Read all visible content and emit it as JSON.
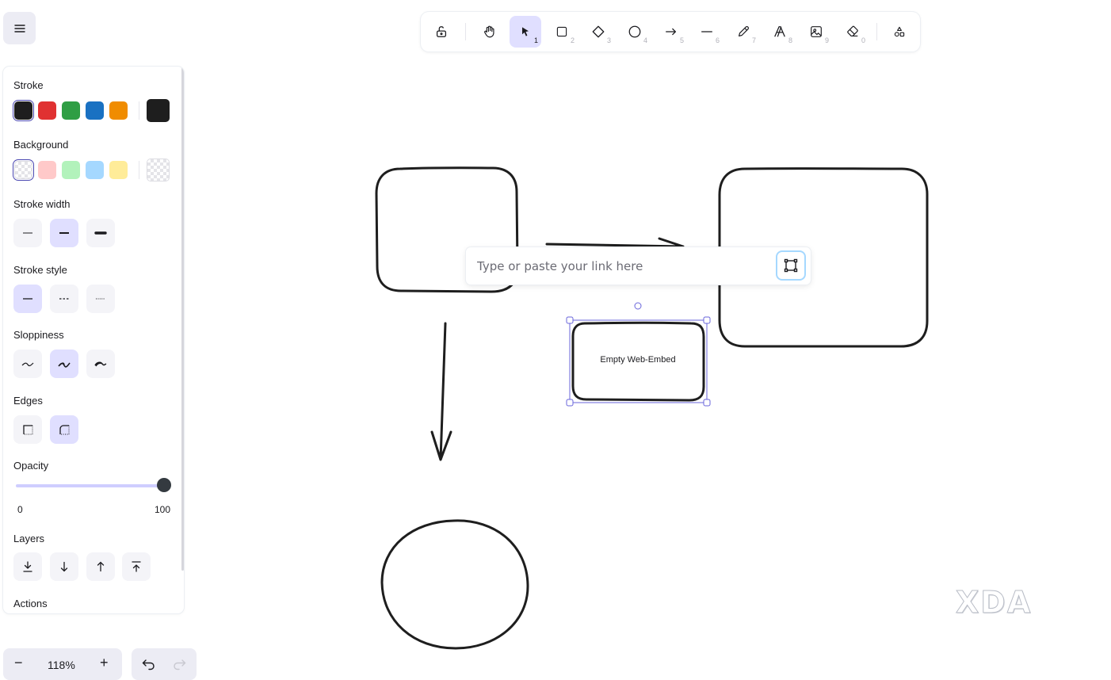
{
  "menu": {
    "icon": "hamburger-icon"
  },
  "toolbar": {
    "tools": [
      {
        "name": "lock",
        "icon": "lock-open-icon",
        "key": ""
      },
      {
        "name": "hand",
        "icon": "hand-icon",
        "key": ""
      },
      {
        "name": "selection",
        "icon": "pointer-icon",
        "key": "1",
        "active": true
      },
      {
        "name": "rectangle",
        "icon": "square-icon",
        "key": "2"
      },
      {
        "name": "diamond",
        "icon": "diamond-icon",
        "key": "3"
      },
      {
        "name": "ellipse",
        "icon": "circle-icon",
        "key": "4"
      },
      {
        "name": "arrow",
        "icon": "arrow-right-icon",
        "key": "5"
      },
      {
        "name": "line",
        "icon": "line-icon",
        "key": "6"
      },
      {
        "name": "draw",
        "icon": "pencil-icon",
        "key": "7"
      },
      {
        "name": "text",
        "icon": "text-icon",
        "key": "8"
      },
      {
        "name": "image",
        "icon": "image-icon",
        "key": "9"
      },
      {
        "name": "eraser",
        "icon": "eraser-icon",
        "key": "0"
      },
      {
        "name": "more-tools",
        "icon": "shapes-icon",
        "key": ""
      }
    ]
  },
  "panel": {
    "stroke_label": "Stroke",
    "stroke_colors": [
      "#1e1e1e",
      "#e03131",
      "#2f9e44",
      "#1971c2",
      "#f08c00"
    ],
    "stroke_current": "#1e1e1e",
    "background_label": "Background",
    "background_colors": [
      "transparent",
      "#ffc9c9",
      "#b2f2bb",
      "#a5d8ff",
      "#ffec99"
    ],
    "background_current": "transparent",
    "stroke_width_label": "Stroke width",
    "stroke_style_label": "Stroke style",
    "sloppiness_label": "Sloppiness",
    "edges_label": "Edges",
    "opacity_label": "Opacity",
    "opacity_min": "0",
    "opacity_max": "100",
    "opacity_value": 100,
    "layers_label": "Layers",
    "actions_label": "Actions"
  },
  "zoom": {
    "minus": "−",
    "value": "118%",
    "plus": "+"
  },
  "link_popup": {
    "placeholder": "Type or paste your link here",
    "value": ""
  },
  "embed": {
    "label": "Empty Web-Embed"
  },
  "watermark": {
    "text": "XDA"
  },
  "accent": "#6965db"
}
